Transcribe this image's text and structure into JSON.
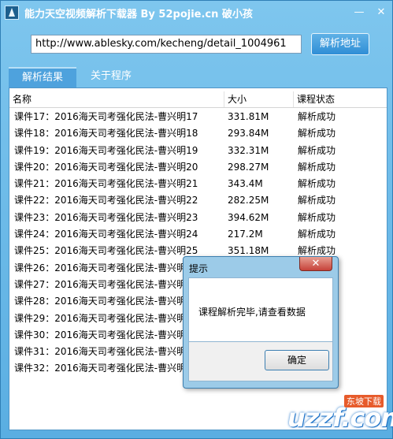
{
  "window": {
    "title": "能力天空视频解析下载器 By 52pojie.cn 破小孩",
    "minimize_glyph": "—",
    "close_glyph": "✕"
  },
  "toolbar": {
    "url_value": "http://www.ablesky.com/kecheng/detail_1004961",
    "parse_label": "解析地址"
  },
  "tabs": [
    {
      "label": "解析结果",
      "active": true
    },
    {
      "label": "关于程序",
      "active": false
    }
  ],
  "table": {
    "headers": {
      "name": "名称",
      "size": "大小",
      "status": "课程状态"
    },
    "rows": [
      {
        "name": "课件17：2016海天司考强化民法-曹兴明17",
        "size": "331.81M",
        "status": "解析成功"
      },
      {
        "name": "课件18：2016海天司考强化民法-曹兴明18",
        "size": "293.84M",
        "status": "解析成功"
      },
      {
        "name": "课件19：2016海天司考强化民法-曹兴明19",
        "size": "332.31M",
        "status": "解析成功"
      },
      {
        "name": "课件20：2016海天司考强化民法-曹兴明20",
        "size": "298.27M",
        "status": "解析成功"
      },
      {
        "name": "课件21：2016海天司考强化民法-曹兴明21",
        "size": "343.4M",
        "status": "解析成功"
      },
      {
        "name": "课件22：2016海天司考强化民法-曹兴明22",
        "size": "282.25M",
        "status": "解析成功"
      },
      {
        "name": "课件23：2016海天司考强化民法-曹兴明23",
        "size": "394.62M",
        "status": "解析成功"
      },
      {
        "name": "课件24：2016海天司考强化民法-曹兴明24",
        "size": "217.2M",
        "status": "解析成功"
      },
      {
        "name": "课件25：2016海天司考强化民法-曹兴明25",
        "size": "351.18M",
        "status": "解析成功"
      },
      {
        "name": "课件26：2016海天司考强化民法-曹兴明",
        "size": "",
        "status": ""
      },
      {
        "name": "课件27：2016海天司考强化民法-曹兴明",
        "size": "",
        "status": ""
      },
      {
        "name": "课件28：2016海天司考强化民法-曹兴明",
        "size": "",
        "status": ""
      },
      {
        "name": "课件29：2016海天司考强化民法-曹兴明",
        "size": "",
        "status": ""
      },
      {
        "name": "课件30：2016海天司考强化民法-曹兴明",
        "size": "",
        "status": ""
      },
      {
        "name": "课件31：2016海天司考强化民法-曹兴明",
        "size": "",
        "status": ""
      },
      {
        "name": "课件32：2016海天司考强化民法-曹兴明",
        "size": "",
        "status": ""
      }
    ]
  },
  "dialog": {
    "title": "提示",
    "message": "课程解析完毕,请查看数据",
    "ok_label": "确定",
    "close_glyph": "✕"
  },
  "watermark": {
    "brand": "uzzf.com",
    "tag": "东坡下载"
  },
  "colors": {
    "window_blue": "#5aaee2",
    "button_blue": "#2f8ed6",
    "dialog_close_red": "#c6423a"
  }
}
